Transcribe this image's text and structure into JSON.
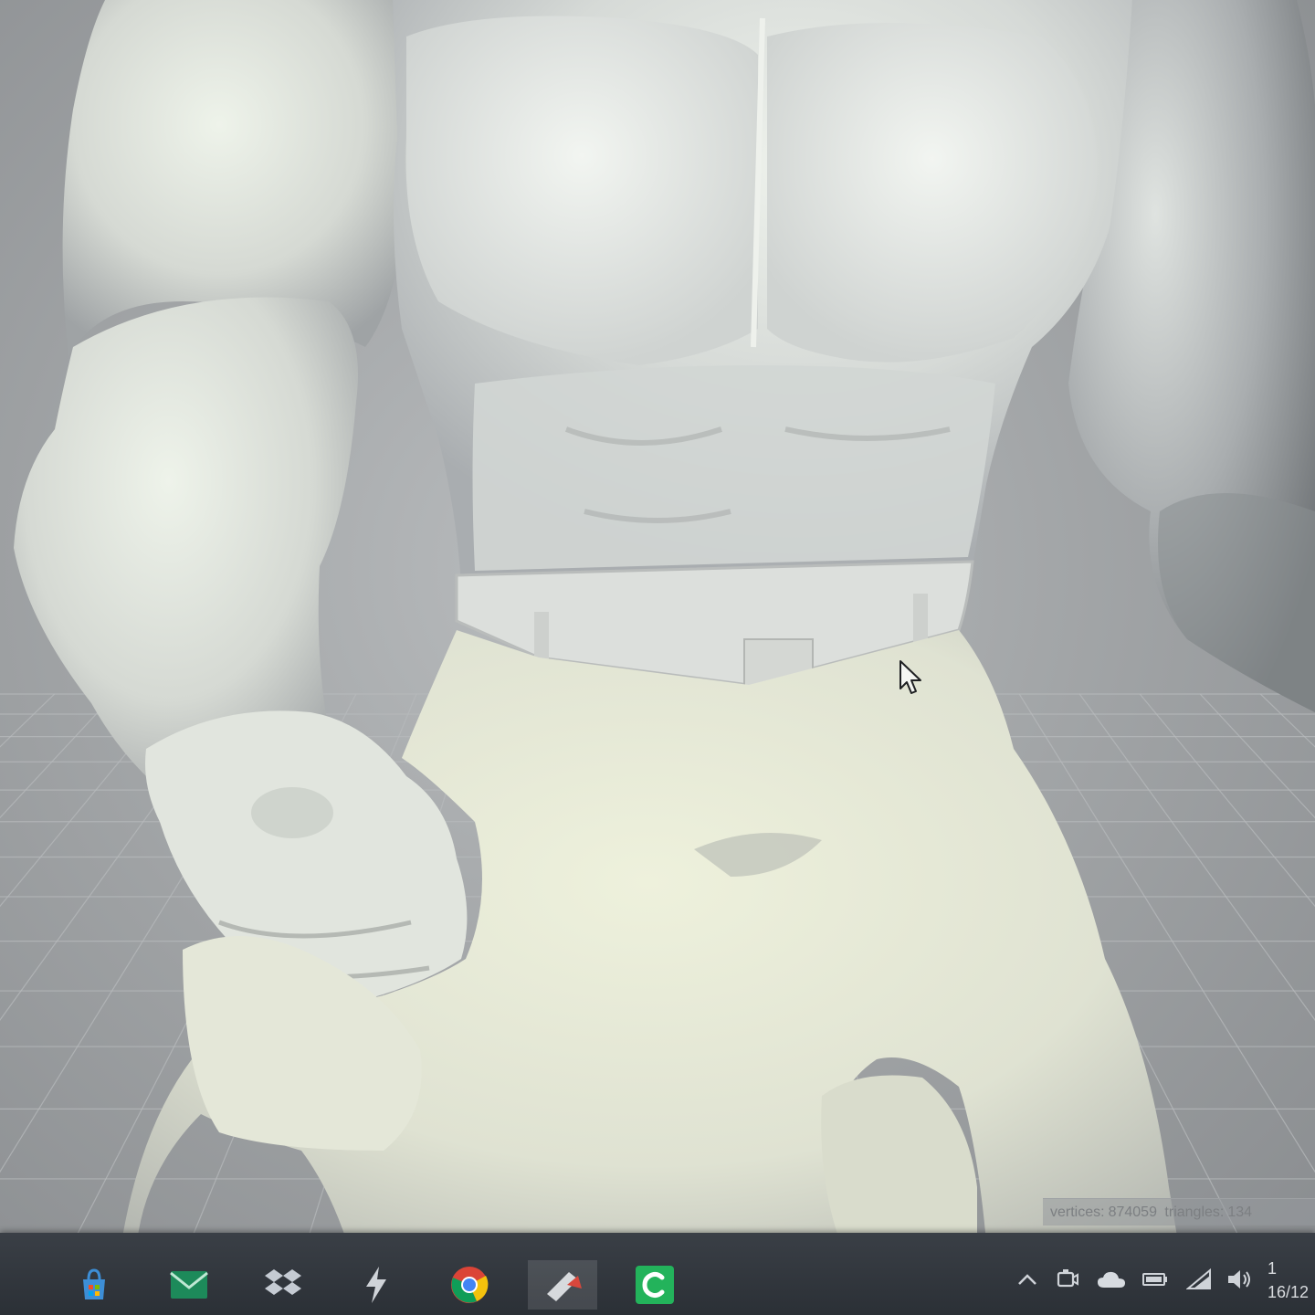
{
  "viewport": {
    "stats": {
      "vertices_label": "vertices:",
      "vertices_value": "874059",
      "triangles_label": "triangles:",
      "triangles_value": "134"
    }
  },
  "taskbar": {
    "apps": [
      {
        "name": "store-icon"
      },
      {
        "name": "mail-icon"
      },
      {
        "name": "dropbox-icon"
      },
      {
        "name": "lightning-app-icon"
      },
      {
        "name": "chrome-icon"
      },
      {
        "name": "modeling-app-icon",
        "active": true
      },
      {
        "name": "green-c-app-icon"
      }
    ],
    "tray": [
      "chevron-up-icon",
      "meet-now-icon",
      "onedrive-icon",
      "battery-icon",
      "wifi-icon",
      "volume-icon"
    ],
    "clock": {
      "time": "1",
      "date": "16/12"
    }
  },
  "colors": {
    "taskbar": "#2b3036",
    "model_light": "#e6ebe4",
    "model_shadow": "#8f9498",
    "grid_line": "#b7babc"
  }
}
